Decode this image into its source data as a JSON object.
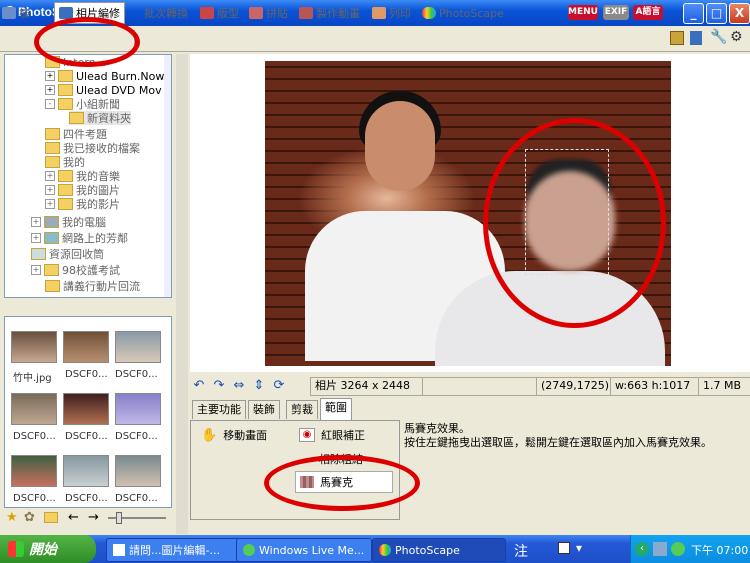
{
  "window": {
    "title": "PhotoScape",
    "title_visible": "PhotoScape",
    "min": "_",
    "max": "□",
    "close": "X"
  },
  "toolbar": {
    "tabs": [
      {
        "label": "相片編修",
        "active": true
      },
      {
        "label": "批次轉換"
      },
      {
        "label": "版型"
      },
      {
        "label": "拼貼"
      },
      {
        "label": "製作動畫"
      },
      {
        "label": "列印"
      },
      {
        "label": "PhotoScape"
      }
    ],
    "partial_tab": "檢",
    "badges": [
      "MENU",
      "EXIF",
      "A語言"
    ]
  },
  "tree": {
    "nodes": [
      {
        "label": "Intern..."
      },
      {
        "label": "Ulead Burn.Now"
      },
      {
        "label": "Ulead DVD Mov"
      },
      {
        "label": "小組新聞"
      },
      {
        "label": "新資料夾"
      },
      {
        "label": "四件考題"
      },
      {
        "label": "我已接收的檔案"
      },
      {
        "label": "我的"
      },
      {
        "label": "我的音樂"
      },
      {
        "label": "我的圖片"
      },
      {
        "label": "我的影片"
      },
      {
        "label": "我的電腦"
      },
      {
        "label": "網路上的芳鄰"
      },
      {
        "label": "資源回收筒"
      },
      {
        "label": "98校護考試"
      },
      {
        "label": "講義行動片回流"
      }
    ]
  },
  "thumbs": {
    "items": [
      {
        "label": "竹中.jpg"
      },
      {
        "label": "DSCF0..."
      },
      {
        "label": "DSCF0..."
      },
      {
        "label": "DSCF0..."
      },
      {
        "label": "DSCF0..."
      },
      {
        "label": "DSCF0..."
      },
      {
        "label": "DSCF0..."
      },
      {
        "label": "DSCF0..."
      },
      {
        "label": "DSCF0..."
      }
    ]
  },
  "status": {
    "photo_size": "相片 3264 x 2448",
    "cursor": "(2749,1725)",
    "selection": "w:663 h:1017",
    "file_size": "1.7 MB"
  },
  "edit_tabs": [
    {
      "label": "主要功能"
    },
    {
      "label": "裝飾"
    },
    {
      "label": "剪裁"
    },
    {
      "label": "範圍",
      "selected": true
    }
  ],
  "edit_panel": {
    "move_label": "移動畫面",
    "redeye_label": "紅眼補正",
    "partial_label": "相除粗結",
    "mosaic_label": "馬賽克"
  },
  "description": {
    "line1": "馬賽克效果。",
    "line2": "按住左鍵拖曳出選取區，鬆開左鍵在選取區內加入馬賽克效果。"
  },
  "taskbar": {
    "start_label": "開始",
    "items": [
      {
        "label": "請問...圖片編輯-..."
      },
      {
        "label": "Windows Live Me..."
      },
      {
        "label": "PhotoScape",
        "active": true
      }
    ],
    "ime": "注",
    "clock": "下午 07:00"
  },
  "colors": {
    "accent": "#0a54d8",
    "annotation": "#dd0000",
    "start": "#3c9a30"
  }
}
